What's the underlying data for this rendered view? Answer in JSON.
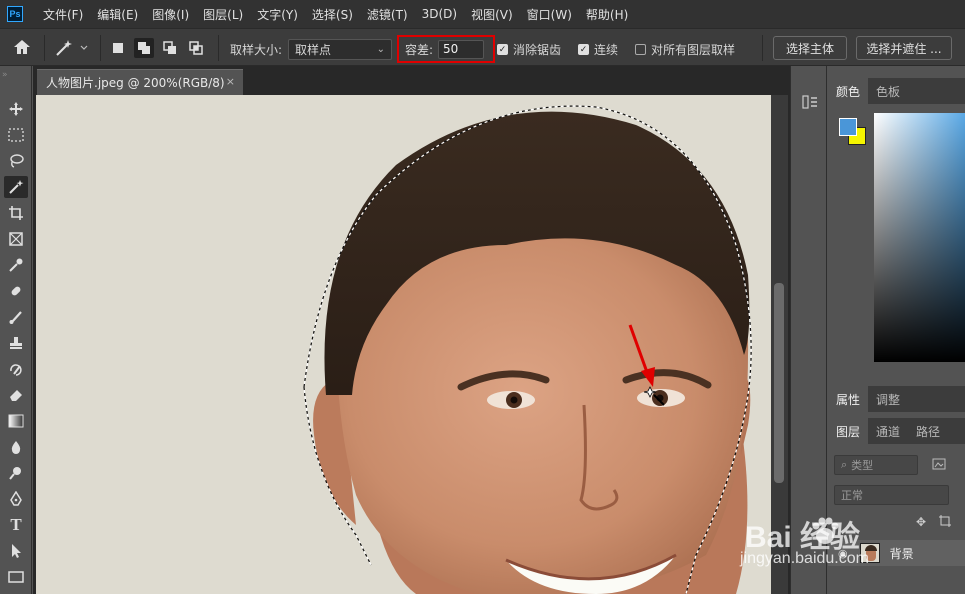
{
  "app": {
    "logo": "Ps"
  },
  "menu": [
    "文件(F)",
    "编辑(E)",
    "图像(I)",
    "图层(L)",
    "文字(Y)",
    "选择(S)",
    "滤镜(T)",
    "3D(D)",
    "视图(V)",
    "窗口(W)",
    "帮助(H)"
  ],
  "options": {
    "sample_size_label": "取样大小:",
    "sample_size_value": "取样点",
    "tolerance_label": "容差:",
    "tolerance_value": "50",
    "anti_alias_label": "消除锯齿",
    "anti_alias_checked": true,
    "contiguous_label": "连续",
    "contiguous_checked": true,
    "sample_all_layers_label": "对所有图层取样",
    "sample_all_layers_checked": false,
    "select_subject_label": "选择主体",
    "select_and_mask_label": "选择并遮住 ..."
  },
  "document": {
    "tab_title": "人物图片.jpeg @ 200%(RGB/8)",
    "close_glyph": "×"
  },
  "panels": {
    "color_tabs": [
      "颜色",
      "色板"
    ],
    "props_tabs": [
      "属性",
      "调整"
    ],
    "layers_tabs": [
      "图层",
      "通道",
      "路径"
    ],
    "layer_filter_placeholder": "类型",
    "blend_mode": "正常",
    "layer_name": "背景",
    "fg_color": "#4a96d8",
    "bg_color": "#f5f500"
  },
  "watermark": {
    "brand": "Bai  经验",
    "url": "jingyan.baidu.com"
  },
  "annotation": {
    "highlight_color": "#e00000",
    "arrow_color": "#e00000"
  }
}
